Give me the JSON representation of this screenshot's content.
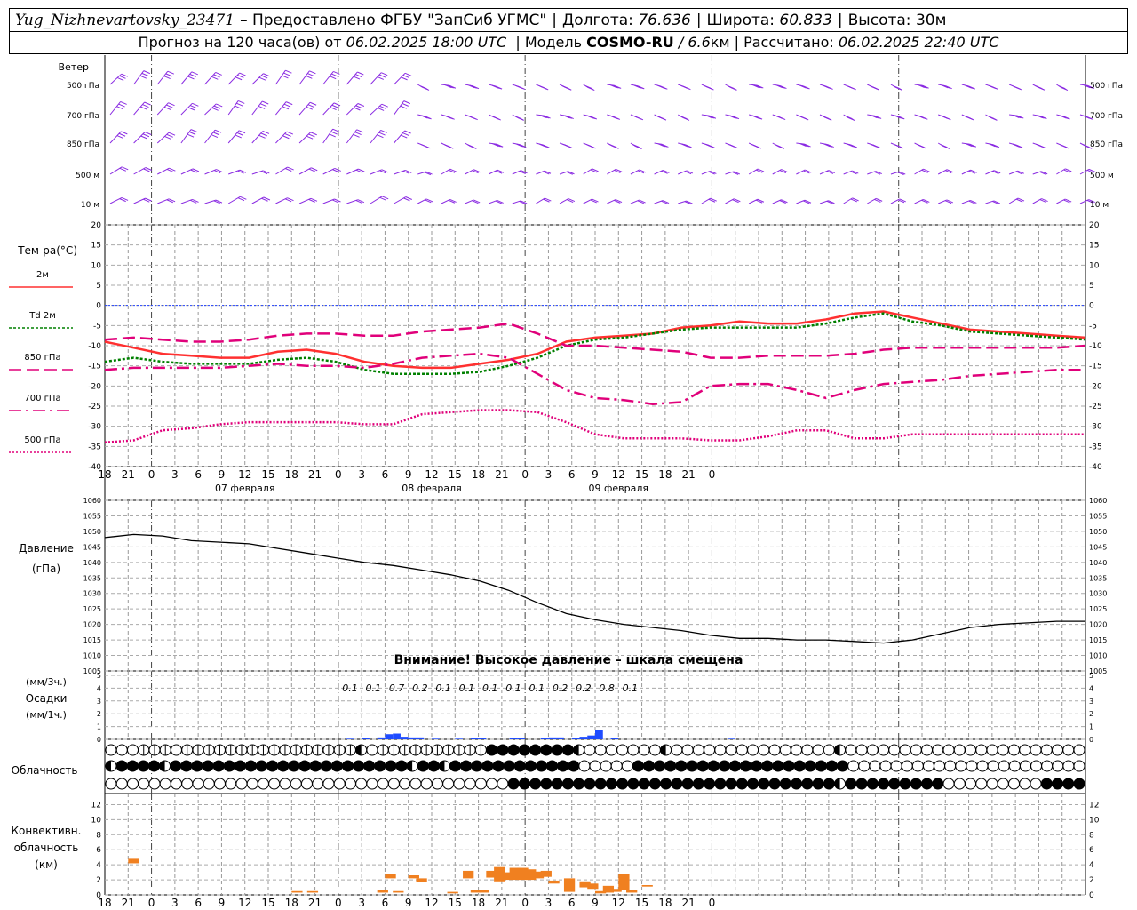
{
  "header": {
    "station": "Yug_Nizhnevartovsky_23471",
    "provider_prefix": "– Предоставлено ФГБУ",
    "provider": "\"ЗапСиб УГМС\"",
    "lon_label": "Долгота:",
    "lon": "76.636",
    "lat_label": "Широта:",
    "lat": "60.833",
    "alt_label": "Высота:",
    "alt": "30м",
    "forecast_prefix": "Прогноз на 120 часа(ов) от",
    "forecast_time": "06.02.2025 18:00 UTC",
    "model_label": "| Модель",
    "model": "COSMO-RU",
    "model_res": "/ 6.6",
    "model_res_unit": "км",
    "calc_label": "| Рассчитано:",
    "calc_time": "06.02.2025 22:40 UTC"
  },
  "panels": {
    "wind": {
      "title": "Ветер",
      "levels": [
        "500 гПа",
        "700 гПа",
        "850 гПа",
        "500 м",
        "10  м"
      ]
    },
    "temp": {
      "title": "Тем-ра(°С)",
      "legend": [
        "2м",
        "Td  2м",
        "850 гПа",
        "700 гПа",
        "500 гПа"
      ]
    },
    "pressure": {
      "title1": "Давление",
      "title2": "(гПа)",
      "warning": "Внимание! Высокое давление – шкала смещена"
    },
    "precip": {
      "title1": "(мм/3ч.)",
      "title2": "Осадки",
      "title3": "(мм/1ч.)"
    },
    "cloud": {
      "title": "Облачность"
    },
    "conv": {
      "title1": "Конвективн.",
      "title2": "облачность",
      "title3": "(км)"
    }
  },
  "chart_data": [
    {
      "type": "line",
      "name": "temperature",
      "x_hours": [
        0,
        3,
        6,
        9,
        12,
        15,
        18,
        21,
        24,
        27,
        30,
        33,
        36,
        39,
        42,
        45,
        48,
        51,
        54,
        57,
        60,
        63,
        66,
        69,
        72,
        75,
        78,
        81,
        84,
        87,
        90,
        93,
        96,
        99,
        102,
        105,
        108,
        111,
        114,
        117,
        120,
        123,
        126
      ],
      "x_tick_labels": [
        "18",
        "21",
        "0",
        "3",
        "6",
        "9",
        "12",
        "15",
        "18",
        "21",
        "0",
        "3",
        "6",
        "9",
        "12",
        "15",
        "18",
        "21",
        "0",
        "3",
        "6",
        "9",
        "12",
        "15",
        "18",
        "21",
        "0"
      ],
      "date_labels": [
        "07 февраля",
        "08 февраля",
        "09 февраля"
      ],
      "ylim": [
        -40,
        20
      ],
      "y_ticks": [
        20,
        15,
        10,
        5,
        0,
        -5,
        -10,
        -15,
        -20,
        -25,
        -30,
        -35,
        -40
      ],
      "series": [
        {
          "name": "2м",
          "color": "#ff3030",
          "style": "solid",
          "values": [
            -9,
            -10.5,
            -12,
            -12.5,
            -13,
            -13,
            -11.5,
            -11,
            -12,
            -14,
            -15,
            -15.5,
            -15.5,
            -14.5,
            -13.5,
            -12,
            -9,
            -8,
            -7.5,
            -7,
            -5.5,
            -5,
            -4,
            -4.5,
            -4.5,
            -3.5,
            -2,
            -1.5,
            -3,
            -4.5,
            -6,
            -6.5,
            -7,
            -7.5,
            -8
          ]
        },
        {
          "name": "Td  2м",
          "color": "#008000",
          "style": "dotted",
          "values": [
            -14,
            -13,
            -14,
            -14.5,
            -14.5,
            -14.5,
            -13.5,
            -13,
            -14,
            -16,
            -17,
            -17,
            -17,
            -16.5,
            -15,
            -13,
            -10,
            -8.5,
            -8,
            -7,
            -6,
            -5.5,
            -5.5,
            -5.5,
            -5.5,
            -4.5,
            -3,
            -2,
            -4,
            -5,
            -6.5,
            -7,
            -7.5,
            -8,
            -8.5
          ]
        },
        {
          "name": "850 гПа",
          "color": "#e0007a",
          "style": "dash",
          "values": [
            -8.5,
            -8,
            -8.5,
            -9,
            -9,
            -8.5,
            -7.5,
            -7,
            -7,
            -7.5,
            -7.5,
            -6.5,
            -6,
            -5.5,
            -4.5,
            -7,
            -10,
            -10,
            -10.5,
            -11,
            -11.5,
            -13,
            -13,
            -12.5,
            -12.5,
            -12.5,
            -12,
            -11,
            -10.5,
            -10.5,
            -10.5,
            -10.5,
            -10.5,
            -10.5,
            -10
          ]
        },
        {
          "name": "700 гПа",
          "color": "#e0007a",
          "style": "dashdot",
          "values": [
            -16,
            -15.5,
            -15.5,
            -15.5,
            -15.5,
            -15,
            -14.5,
            -15,
            -15,
            -15.5,
            -14.5,
            -13,
            -12.5,
            -12,
            -13,
            -17,
            -21,
            -23,
            -23.5,
            -24.5,
            -24,
            -20,
            -19.5,
            -19.5,
            -21,
            -23,
            -21,
            -19.5,
            -19,
            -18.5,
            -17.5,
            -17,
            -16.5,
            -16,
            -16
          ]
        },
        {
          "name": "500 гПа",
          "color": "#e0007a",
          "style": "densedot",
          "values": [
            -34,
            -33.5,
            -31,
            -30.5,
            -29.5,
            -29,
            -29,
            -29,
            -29,
            -29.5,
            -29.5,
            -27,
            -26.5,
            -26,
            -26,
            -26.5,
            -29,
            -32,
            -33,
            -33,
            -33,
            -33.5,
            -33.5,
            -32.5,
            -31,
            -31,
            -33,
            -33,
            -32,
            -32,
            -32,
            -32,
            -32,
            -32,
            -32
          ]
        }
      ]
    },
    {
      "type": "line",
      "name": "pressure",
      "ylim": [
        1005,
        1060
      ],
      "y_ticks": [
        1060,
        1055,
        1050,
        1045,
        1040,
        1035,
        1030,
        1025,
        1020,
        1015,
        1010,
        1005
      ],
      "series": [
        {
          "name": "",
          "color": "#000000",
          "values": [
            1048,
            1049,
            1048.5,
            1047,
            1046.5,
            1046,
            1044.5,
            1043,
            1041.5,
            1040,
            1039,
            1037.5,
            1036,
            1034,
            1031,
            1027,
            1023.5,
            1021.5,
            1020,
            1019,
            1018,
            1016.5,
            1015.5,
            1015.5,
            1015,
            1015,
            1014.5,
            1014,
            1015,
            1017,
            1019,
            1020,
            1020.5,
            1021,
            1021
          ]
        }
      ]
    },
    {
      "type": "bar",
      "name": "precipitation",
      "ylim": [
        0,
        5
      ],
      "y_ticks": [
        5,
        4,
        3,
        2,
        1,
        0
      ],
      "labels": [
        {
          "x": 30,
          "text": "0.1"
        },
        {
          "x": 33,
          "text": "0.1"
        },
        {
          "x": 36,
          "text": "0.7"
        },
        {
          "x": 39,
          "text": "0.2"
        },
        {
          "x": 42,
          "text": "0.1"
        },
        {
          "x": 45,
          "text": "0.1"
        },
        {
          "x": 48,
          "text": "0.1"
        },
        {
          "x": 51,
          "text": "0.1"
        },
        {
          "x": 54,
          "text": "0.1"
        },
        {
          "x": 57,
          "text": "0.2"
        },
        {
          "x": 60,
          "text": "0.2"
        },
        {
          "x": 63,
          "text": "0.8"
        },
        {
          "x": 66,
          "text": "0.1"
        }
      ],
      "bars": [
        {
          "x": 31,
          "v": 0.05
        },
        {
          "x": 33,
          "v": 0.1
        },
        {
          "x": 35,
          "v": 0.15
        },
        {
          "x": 36,
          "v": 0.4
        },
        {
          "x": 37,
          "v": 0.45
        },
        {
          "x": 38,
          "v": 0.2
        },
        {
          "x": 39,
          "v": 0.15
        },
        {
          "x": 40,
          "v": 0.15
        },
        {
          "x": 42,
          "v": 0.05
        },
        {
          "x": 45,
          "v": 0.05
        },
        {
          "x": 47,
          "v": 0.1
        },
        {
          "x": 48,
          "v": 0.1
        },
        {
          "x": 52,
          "v": 0.1
        },
        {
          "x": 53,
          "v": 0.1
        },
        {
          "x": 56,
          "v": 0.1
        },
        {
          "x": 57,
          "v": 0.15
        },
        {
          "x": 58,
          "v": 0.15
        },
        {
          "x": 60,
          "v": 0.1
        },
        {
          "x": 61,
          "v": 0.2
        },
        {
          "x": 62,
          "v": 0.3
        },
        {
          "x": 63,
          "v": 0.7
        },
        {
          "x": 65,
          "v": 0.1
        },
        {
          "x": 80,
          "v": 0.05
        }
      ]
    },
    {
      "type": "bar",
      "name": "convective_cloud",
      "ylim": [
        0,
        13
      ],
      "y_ticks": [
        0,
        2,
        4,
        6,
        8,
        10,
        12
      ],
      "bars": [
        {
          "x": 3,
          "lo": 4.2,
          "hi": 4.8
        },
        {
          "x": 24,
          "lo": 0.3,
          "hi": 0.5
        },
        {
          "x": 26,
          "lo": 0.3,
          "hi": 0.5
        },
        {
          "x": 35,
          "lo": 0.3,
          "hi": 0.6
        },
        {
          "x": 36,
          "lo": 2.2,
          "hi": 2.8
        },
        {
          "x": 37,
          "lo": 0.3,
          "hi": 0.5
        },
        {
          "x": 39,
          "lo": 2.2,
          "hi": 2.6
        },
        {
          "x": 40,
          "lo": 1.7,
          "hi": 2.2
        },
        {
          "x": 44,
          "lo": 0.2,
          "hi": 0.4
        },
        {
          "x": 46,
          "lo": 2.2,
          "hi": 3.2
        },
        {
          "x": 47,
          "lo": 0.3,
          "hi": 0.6
        },
        {
          "x": 48,
          "lo": 0.3,
          "hi": 0.6
        },
        {
          "x": 49,
          "lo": 2.3,
          "hi": 3.2
        },
        {
          "x": 50,
          "lo": 1.8,
          "hi": 3.7
        },
        {
          "x": 51,
          "lo": 2.0,
          "hi": 3.0
        },
        {
          "x": 52,
          "lo": 2.0,
          "hi": 3.6
        },
        {
          "x": 53,
          "lo": 2.0,
          "hi": 3.6
        },
        {
          "x": 54,
          "lo": 2.0,
          "hi": 3.4
        },
        {
          "x": 55,
          "lo": 2.2,
          "hi": 3.1
        },
        {
          "x": 56,
          "lo": 2.4,
          "hi": 3.2
        },
        {
          "x": 57,
          "lo": 1.5,
          "hi": 1.9
        },
        {
          "x": 59,
          "lo": 0.4,
          "hi": 2.2
        },
        {
          "x": 61,
          "lo": 1.0,
          "hi": 1.8
        },
        {
          "x": 62,
          "lo": 0.8,
          "hi": 1.5
        },
        {
          "x": 63,
          "lo": 0.2,
          "hi": 0.5
        },
        {
          "x": 64,
          "lo": 0.3,
          "hi": 1.2
        },
        {
          "x": 65,
          "lo": 0.4,
          "hi": 0.8
        },
        {
          "x": 66,
          "lo": 0.6,
          "hi": 2.8
        },
        {
          "x": 67,
          "lo": 0.3,
          "hi": 0.6
        },
        {
          "x": 69,
          "lo": 1.1,
          "hi": 1.3
        }
      ]
    }
  ],
  "cloud_rows": {
    "legend_note": "o=clear, f=overcast, h=half, q=quarter, t=three-quarter",
    "upper": "oooqqqoqqqqqqqqqqqqqqqqhoqqqqqqqqqqffffffffhooooooohooooooooooooooohoooooooooooooooooooooo",
    "middle": "hffffhffffffffffffffffffffffhffhffffffffffffoooooffffffffffffffffffffoooooooooooooooooooooo",
    "lower": "oooooooooooooooooooooooooooooooooooooffffffffffffffffffffffffffffffhfffffffffoooooooooffff"
  },
  "colors": {
    "wind": "#8a2be2",
    "temp2m": "#ff3030",
    "td": "#008000",
    "upper": "#e0007a",
    "precip": "#1f4cff",
    "conv": "#f08020",
    "zero_line": "#2040ff"
  }
}
